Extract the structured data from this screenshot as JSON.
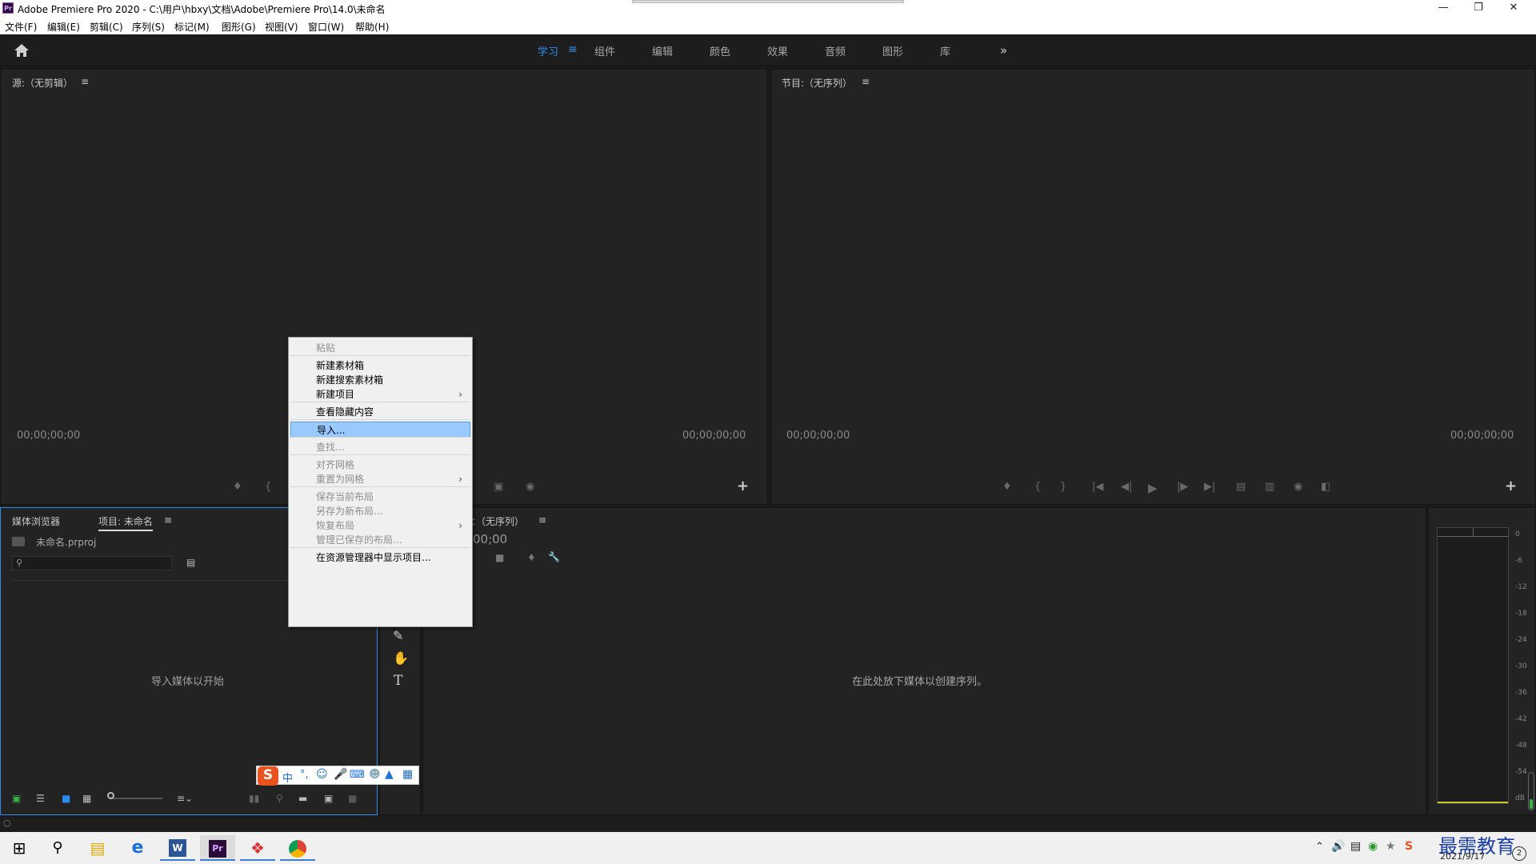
{
  "window": {
    "title": "Adobe Premiere Pro 2020 - C:\\用户\\hbxy\\文档\\Adobe\\Premiere Pro\\14.0\\未命名",
    "app_icon": "Pr",
    "controls": [
      "minimize-icon",
      "restore-icon",
      "close-icon"
    ]
  },
  "menu": [
    "文件(F)",
    "编辑(E)",
    "剪辑(C)",
    "序列(S)",
    "标记(M)",
    "图形(G)",
    "视图(V)",
    "窗口(W)",
    "帮助(H)"
  ],
  "workspaces": {
    "items": [
      "学习",
      "组件",
      "编辑",
      "颜色",
      "效果",
      "音频",
      "图形",
      "库"
    ],
    "active": "学习",
    "more": "»"
  },
  "source_panel": {
    "title": "源:（无剪辑）",
    "tc_left": "00;00;00;00",
    "tc_right": "00;00;00;00"
  },
  "program_panel": {
    "title": "节目:（无序列）",
    "tc_left": "00;00;00;00",
    "tc_right": "00;00;00;00"
  },
  "project_panel": {
    "tabs": [
      "媒体浏览器",
      "项目: 未命名"
    ],
    "active_tab": "项目: 未命名",
    "file": "未命名.prproj",
    "placeholder": "导入媒体以开始"
  },
  "timeline_panel": {
    "title": "：（无序列）",
    "tc": "00;00",
    "placeholder": "在此处放下媒体以创建序列。"
  },
  "meter": {
    "scale": [
      "0",
      "-6",
      "-12",
      "-18",
      "-24",
      "-30",
      "-36",
      "-42",
      "-48",
      "-54",
      "dB"
    ]
  },
  "context_menu": {
    "items": [
      {
        "label": "粘贴",
        "disabled": true
      },
      {
        "sep": true
      },
      {
        "label": "新建素材箱"
      },
      {
        "label": "新建搜索素材箱"
      },
      {
        "label": "新建项目",
        "submenu": true
      },
      {
        "sep": true
      },
      {
        "label": "查看隐藏内容"
      },
      {
        "sep": true
      },
      {
        "label": "导入...",
        "highlighted": true
      },
      {
        "sep": true
      },
      {
        "label": "查找...",
        "disabled": true
      },
      {
        "sep": true
      },
      {
        "label": "对齐网格",
        "disabled": true
      },
      {
        "label": "重置为网格",
        "disabled": true,
        "submenu": true
      },
      {
        "sep": true
      },
      {
        "label": "保存当前布局",
        "disabled": true
      },
      {
        "label": "另存为新布局...",
        "disabled": true
      },
      {
        "label": "恢复布局",
        "disabled": true,
        "submenu": true
      },
      {
        "label": "管理已保存的布局...",
        "disabled": true
      },
      {
        "sep": true
      },
      {
        "label": "在资源管理器中显示项目..."
      }
    ]
  },
  "ime_bar": {
    "lang": "中"
  },
  "taskbar": {
    "date": "2021/9/17",
    "watermark": "最需教育"
  },
  "colors": {
    "accent": "#2d8ceb",
    "highlight": "#99c9ff",
    "panel": "#232323",
    "titlebar": "#ffffff"
  }
}
